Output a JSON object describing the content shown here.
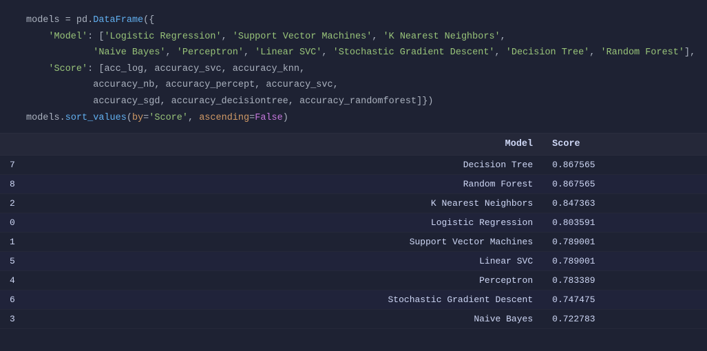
{
  "code": {
    "lines": [
      {
        "num": "",
        "tokens": [
          {
            "text": "models",
            "class": "kw-white"
          },
          {
            "text": " = ",
            "class": "kw-white"
          },
          {
            "text": "pd",
            "class": "kw-white"
          },
          {
            "text": ".",
            "class": "kw-white"
          },
          {
            "text": "DataFrame",
            "class": "kw-blue"
          },
          {
            "text": "({",
            "class": "kw-white"
          }
        ]
      },
      {
        "num": "",
        "tokens": [
          {
            "text": "    'Model'",
            "class": "kw-green"
          },
          {
            "text": ": [",
            "class": "kw-white"
          },
          {
            "text": "'Logistic Regression'",
            "class": "kw-green"
          },
          {
            "text": ", ",
            "class": "kw-white"
          },
          {
            "text": "'Support Vector Machines'",
            "class": "kw-green"
          },
          {
            "text": ", ",
            "class": "kw-white"
          },
          {
            "text": "'K Nearest Neighbors'",
            "class": "kw-green"
          },
          {
            "text": ",",
            "class": "kw-white"
          }
        ]
      },
      {
        "num": "",
        "tokens": [
          {
            "text": "            ",
            "class": "kw-white"
          },
          {
            "text": "'Naive Bayes'",
            "class": "kw-green"
          },
          {
            "text": ", ",
            "class": "kw-white"
          },
          {
            "text": "'Perceptron'",
            "class": "kw-green"
          },
          {
            "text": ", ",
            "class": "kw-white"
          },
          {
            "text": "'Linear SVC'",
            "class": "kw-green"
          },
          {
            "text": ", ",
            "class": "kw-white"
          },
          {
            "text": "'Stochastic Gradient Descent'",
            "class": "kw-green"
          },
          {
            "text": ", ",
            "class": "kw-white"
          },
          {
            "text": "'Decision Tree'",
            "class": "kw-green"
          },
          {
            "text": ", ",
            "class": "kw-white"
          },
          {
            "text": "'Random Forest'",
            "class": "kw-green"
          },
          {
            "text": "],",
            "class": "kw-white"
          }
        ]
      },
      {
        "num": "",
        "tokens": [
          {
            "text": "    'Score'",
            "class": "kw-green"
          },
          {
            "text": ": [",
            "class": "kw-white"
          },
          {
            "text": "acc_log",
            "class": "kw-white"
          },
          {
            "text": ", ",
            "class": "kw-white"
          },
          {
            "text": "accuracy_svc",
            "class": "kw-white"
          },
          {
            "text": ", ",
            "class": "kw-white"
          },
          {
            "text": "accuracy_knn",
            "class": "kw-white"
          },
          {
            "text": ",",
            "class": "kw-white"
          }
        ]
      },
      {
        "num": "",
        "tokens": [
          {
            "text": "            ",
            "class": "kw-white"
          },
          {
            "text": "accuracy_nb",
            "class": "kw-white"
          },
          {
            "text": ", ",
            "class": "kw-white"
          },
          {
            "text": "accuracy_percept",
            "class": "kw-white"
          },
          {
            "text": ", ",
            "class": "kw-white"
          },
          {
            "text": "accuracy_svc",
            "class": "kw-white"
          },
          {
            "text": ",",
            "class": "kw-white"
          }
        ]
      },
      {
        "num": "",
        "tokens": [
          {
            "text": "            ",
            "class": "kw-white"
          },
          {
            "text": "accuracy_sgd",
            "class": "kw-white"
          },
          {
            "text": ", ",
            "class": "kw-white"
          },
          {
            "text": "accuracy_decisiontree",
            "class": "kw-white"
          },
          {
            "text": ", ",
            "class": "kw-white"
          },
          {
            "text": "accuracy_randomforest",
            "class": "kw-white"
          },
          {
            "text": "]})",
            "class": "kw-white"
          }
        ]
      },
      {
        "num": "",
        "tokens": [
          {
            "text": "models",
            "class": "kw-white"
          },
          {
            "text": ".",
            "class": "kw-white"
          },
          {
            "text": "sort_values",
            "class": "kw-blue"
          },
          {
            "text": "(",
            "class": "kw-white"
          },
          {
            "text": "by",
            "class": "kw-orange"
          },
          {
            "text": "=",
            "class": "kw-white"
          },
          {
            "text": "'Score'",
            "class": "kw-green"
          },
          {
            "text": ", ",
            "class": "kw-white"
          },
          {
            "text": "ascending",
            "class": "kw-orange"
          },
          {
            "text": "=",
            "class": "kw-white"
          },
          {
            "text": "False",
            "class": "kw-purple"
          },
          {
            "text": ")",
            "class": "kw-white"
          }
        ]
      }
    ]
  },
  "table": {
    "headers": {
      "index": "",
      "model": "Model",
      "score": "Score"
    },
    "rows": [
      {
        "index": "7",
        "model": "Decision Tree",
        "score": "0.867565"
      },
      {
        "index": "8",
        "model": "Random Forest",
        "score": "0.867565"
      },
      {
        "index": "2",
        "model": "K Nearest Neighbors",
        "score": "0.847363"
      },
      {
        "index": "0",
        "model": "Logistic Regression",
        "score": "0.803591"
      },
      {
        "index": "1",
        "model": "Support Vector Machines",
        "score": "0.789001"
      },
      {
        "index": "5",
        "model": "Linear SVC",
        "score": "0.789001"
      },
      {
        "index": "4",
        "model": "Perceptron",
        "score": "0.783389"
      },
      {
        "index": "6",
        "model": "Stochastic Gradient Descent",
        "score": "0.747475"
      },
      {
        "index": "3",
        "model": "Naive Bayes",
        "score": "0.722783"
      }
    ]
  }
}
